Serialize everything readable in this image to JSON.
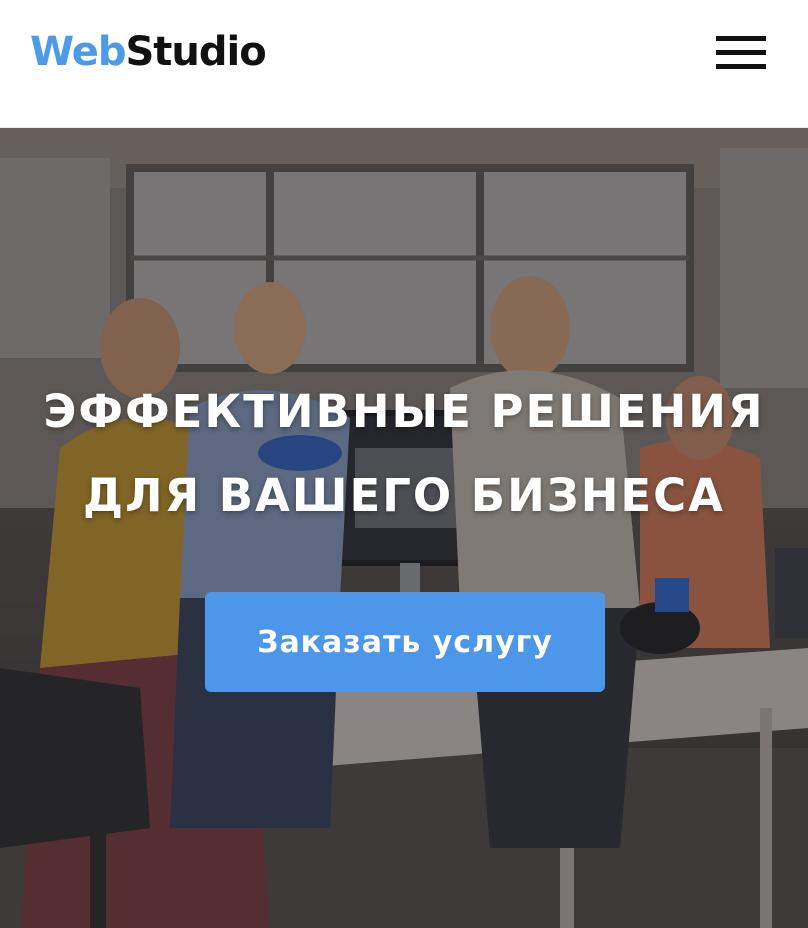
{
  "header": {
    "logo_part1": "Web",
    "logo_part2": "Studio",
    "menu_icon": "hamburger-menu-icon"
  },
  "hero": {
    "title_line1": "ЭФФЕКТИВНЫЕ РЕШЕНИЯ",
    "title_line2": "ДЛЯ ВАШЕГО БИЗНЕСА",
    "cta_label": "Заказать услугу",
    "background_image": "team-working-in-office-photo"
  },
  "colors": {
    "brand_blue": "#4d9ae8",
    "button_blue": "#4c97ea",
    "dark_text": "#111111",
    "hero_text": "#ffffff"
  }
}
